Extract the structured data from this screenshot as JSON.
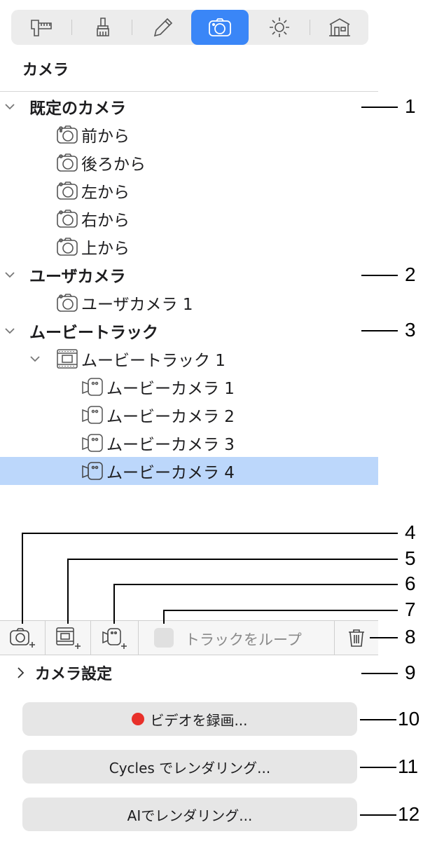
{
  "panel": {
    "title": "カメラ"
  },
  "toolbar": {
    "tabs": [
      {
        "icon": "caliper-ruler-icon"
      },
      {
        "icon": "brush-icon"
      },
      {
        "icon": "pencil-icon"
      },
      {
        "icon": "camera-icon",
        "active": true
      },
      {
        "icon": "sun-icon"
      },
      {
        "icon": "house-icon"
      }
    ]
  },
  "tree": {
    "default_cameras": {
      "label": "既定のカメラ",
      "items": [
        "前から",
        "後ろから",
        "左から",
        "右から",
        "上から"
      ]
    },
    "user_cameras": {
      "label": "ユーザカメラ",
      "items": [
        "ユーザカメラ 1"
      ]
    },
    "movie_tracks": {
      "label": "ムービートラック",
      "track": "ムービートラック 1",
      "items": [
        "ムービーカメラ 1",
        "ムービーカメラ 2",
        "ムービーカメラ 3",
        "ムービーカメラ 4"
      ],
      "selected_index": 3
    }
  },
  "bottom_toolbar": {
    "loop_label": "トラックをループ",
    "icons": [
      "add-camera-icon",
      "add-track-icon",
      "add-movie-camera-icon",
      "trash-icon"
    ]
  },
  "settings": {
    "label": "カメラ設定"
  },
  "buttons": {
    "record": "ビデオを録画...",
    "record_dot_color": "#e8302a",
    "cycles": "Cycles でレンダリング...",
    "ai": "AIでレンダリング..."
  },
  "callouts": [
    "1",
    "2",
    "3",
    "4",
    "5",
    "6",
    "7",
    "8",
    "9",
    "10",
    "11",
    "12"
  ],
  "colors": {
    "accent": "#3a86f7",
    "selection": "#bcd7fb"
  }
}
